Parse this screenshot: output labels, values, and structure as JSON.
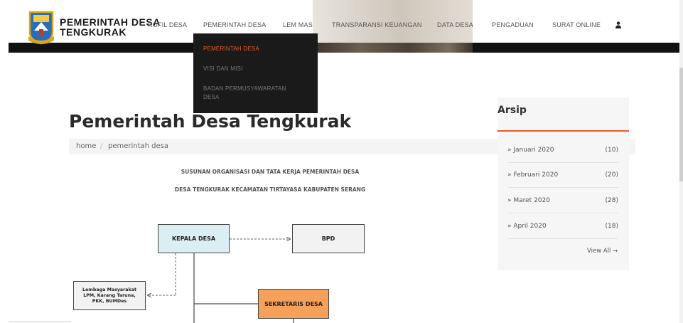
{
  "header": {
    "brand_line1": "PEMERINTAH DESA",
    "brand_line2": "TENGKURAK",
    "nav": [
      {
        "label": "ROFIL DESA"
      },
      {
        "label": "PEMERINTAH DESA"
      },
      {
        "label": "LEM MAS"
      },
      {
        "label": "TRANSPARANSI KEUANGAN"
      },
      {
        "label": "DATA DESA"
      },
      {
        "label": "PENGADUAN"
      },
      {
        "label": "SURAT ONLINE"
      }
    ],
    "user_icon": "user-icon"
  },
  "dropdown": {
    "items": [
      {
        "label": "PEMERINTAH DESA",
        "active": true
      },
      {
        "label": "VISI DAN MISI"
      },
      {
        "label": "BADAN PERMUSYAWARATAN",
        "label2": "DESA"
      }
    ]
  },
  "main": {
    "title": "Pemerintah Desa Tengkurak",
    "breadcrumb": {
      "home": "home",
      "sep": "/",
      "current": "pemerintah desa"
    },
    "org_heading1": "SUSUNAN ORGANISASI DAN TATA KERJA PEMERINTAH DESA",
    "org_heading2": "DESA TENGKURAK KECAMATAN TIRTAYASA KABUPATEN SERANG",
    "chart": {
      "kepala": "KEPALA DESA",
      "bpd": "BPD",
      "lembaga_l1": "Lembaga Masyarakat",
      "lembaga_l2": "LPM, Karang Taruna,",
      "lembaga_l3": "PKK, BUMDes",
      "sekretaris": "SEKRETARIS DESA"
    }
  },
  "sidebar": {
    "title": "Arsip",
    "items": [
      {
        "label": "» Januari 2020",
        "count": "(10)"
      },
      {
        "label": "» Februari 2020",
        "count": "(20)"
      },
      {
        "label": "» Maret 2020",
        "count": "(28)"
      },
      {
        "label": "» April 2020",
        "count": "(18)"
      }
    ],
    "view_all": "View All ➞"
  },
  "colors": {
    "accent": "#ea5a2a",
    "kepala_box": "#dbeef4",
    "sekretaris_box": "#f5a15a"
  }
}
